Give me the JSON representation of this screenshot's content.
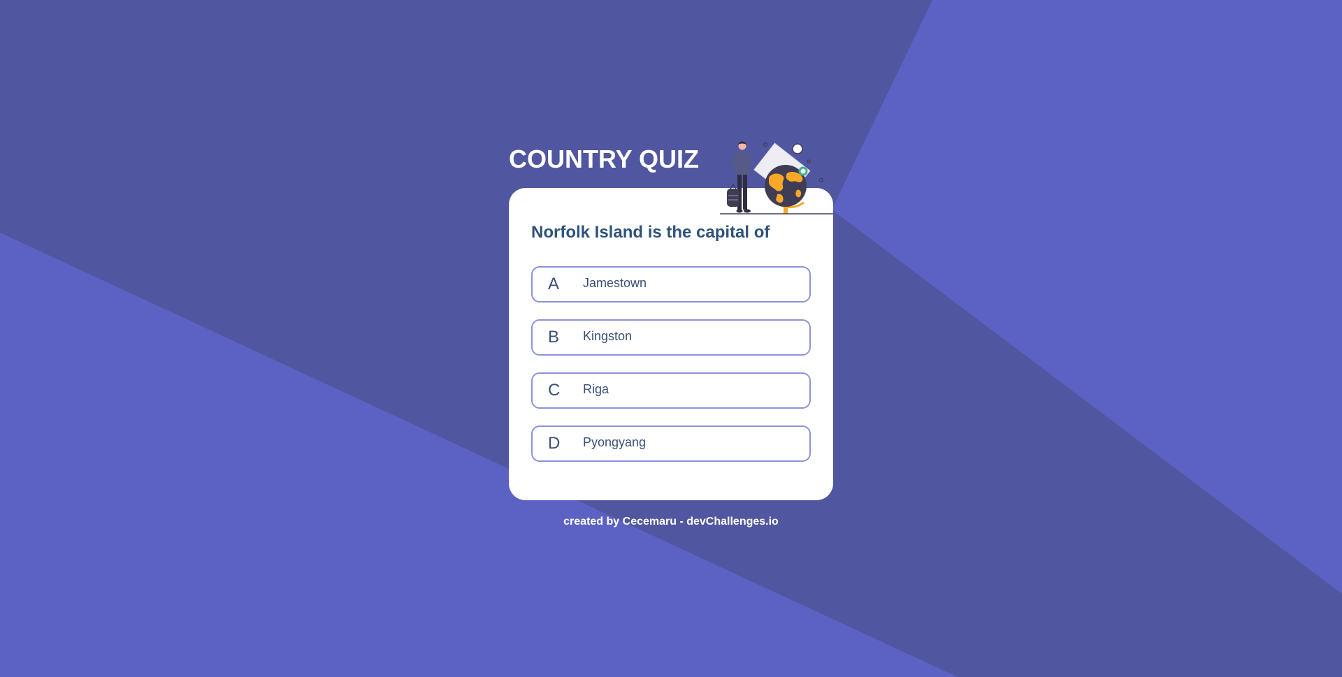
{
  "app": {
    "title": "COUNTRY QUIZ",
    "illustration_icon": "traveler-globe-icon"
  },
  "colors": {
    "background": "#5C62C4",
    "background_band": "#5156A0",
    "card": "#FFFFFF",
    "question_text": "#2F527B",
    "option_border": "#8E92DC"
  },
  "quiz": {
    "question": "Norfolk Island is the capital of",
    "options": [
      {
        "letter": "A",
        "text": "Jamestown"
      },
      {
        "letter": "B",
        "text": "Kingston"
      },
      {
        "letter": "C",
        "text": "Riga"
      },
      {
        "letter": "D",
        "text": "Pyongyang"
      }
    ]
  },
  "footer": {
    "credit": "created by Cecemaru - devChallenges.io"
  }
}
